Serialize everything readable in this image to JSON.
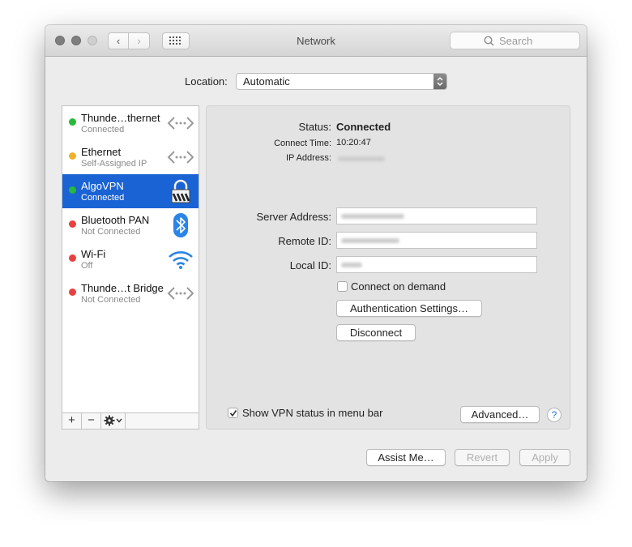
{
  "window": {
    "title": "Network"
  },
  "search": {
    "placeholder": "Search"
  },
  "location": {
    "label": "Location:",
    "value": "Automatic"
  },
  "services": [
    {
      "name": "Thunde…thernet",
      "status": "Connected",
      "dot": "#27b83c",
      "icon": "ethernet-arrows-icon"
    },
    {
      "name": "Ethernet",
      "status": "Self-Assigned IP",
      "dot": "#f0b12b",
      "icon": "ethernet-arrows-icon"
    },
    {
      "name": "AlgoVPN",
      "status": "Connected",
      "dot": "#27b83c",
      "icon": "vpn-lock-icon",
      "selected": true
    },
    {
      "name": "Bluetooth PAN",
      "status": "Not Connected",
      "dot": "#e84040",
      "icon": "bluetooth-icon"
    },
    {
      "name": "Wi-Fi",
      "status": "Off",
      "dot": "#e84040",
      "icon": "wifi-icon"
    },
    {
      "name": "Thunde…t Bridge",
      "status": "Not Connected",
      "dot": "#e84040",
      "icon": "ethernet-arrows-icon"
    }
  ],
  "sidebar_controls": {
    "add": "+",
    "remove": "−"
  },
  "detail": {
    "status_label": "Status:",
    "status_value": "Connected",
    "connect_time_label": "Connect Time:",
    "connect_time_value": "10:20:47",
    "ip_label": "IP Address:",
    "server_label": "Server Address:",
    "remote_label": "Remote ID:",
    "local_label": "Local ID:",
    "connect_on_demand": "Connect on demand",
    "connect_on_demand_checked": false,
    "auth_button": "Authentication Settings…",
    "disconnect_button": "Disconnect",
    "show_vpn_status": "Show VPN status in menu bar",
    "show_vpn_status_checked": true,
    "advanced_button": "Advanced…",
    "help": "?"
  },
  "footer": {
    "assist": "Assist Me…",
    "revert": "Revert",
    "apply": "Apply"
  },
  "colors": {
    "accent": "#1a63d4",
    "green": "#27b83c",
    "amber": "#f0b12b",
    "red": "#e84040"
  }
}
